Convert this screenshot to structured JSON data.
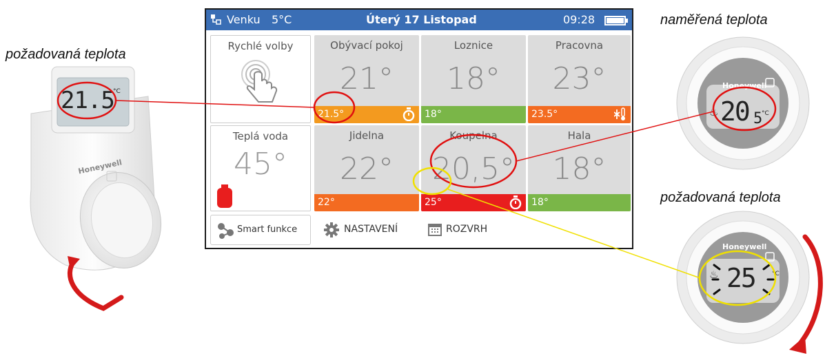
{
  "captions": {
    "left_setpoint": "požadovaná teplota",
    "measured": "naměřená teplota",
    "right_setpoint": "požadovaná teplota"
  },
  "topbar": {
    "outside_label": "Venku",
    "outside_temp": "5°C",
    "date": "Úterý 17 Listopad",
    "time": "09:28"
  },
  "quick": {
    "label": "Rychlé volby"
  },
  "hot_water": {
    "label": "Teplá voda",
    "value": "45°"
  },
  "rooms": [
    {
      "name": "Obývací pokoj",
      "temp": "21°",
      "setpoint": "21.5°",
      "bar_color": "#f39a1f",
      "icon": "timer-icon"
    },
    {
      "name": "Loznice",
      "temp": "18°",
      "setpoint": "18°",
      "bar_color": "#7ab648",
      "icon": ""
    },
    {
      "name": "Pracovna",
      "temp": "23°",
      "setpoint": "23.5°",
      "bar_color": "#f36b21",
      "icon": "snowflake-thermometer-icon"
    },
    {
      "name": "Jidelna",
      "temp": "22°",
      "setpoint": "22°",
      "bar_color": "#f36b21",
      "icon": ""
    },
    {
      "name": "Koupelna",
      "temp": "20,5°",
      "setpoint": "25°",
      "bar_color": "#e81e1e",
      "icon": "timer-icon"
    },
    {
      "name": "Hala",
      "temp": "18°",
      "setpoint": "18°",
      "bar_color": "#7ab648",
      "icon": ""
    }
  ],
  "bottom": {
    "smart": "Smart funkce",
    "settings": "NASTAVENÍ",
    "schedule": "ROZVRH"
  },
  "devices": {
    "trv_display": "21.5",
    "trv_unit": "°C",
    "trv_brand": "Honeywell",
    "round_brand": "Honeywell",
    "round_measured": "20",
    "round_measured_decimal": "5",
    "round_unit": "°C",
    "round_setpoint": "25",
    "round_setpoint_unit": "°C"
  },
  "colors": {
    "topbar": "#3a6eb5",
    "callout_red": "#e01010",
    "callout_yellow": "#f0e000",
    "arrow_red": "#d41a1a"
  }
}
